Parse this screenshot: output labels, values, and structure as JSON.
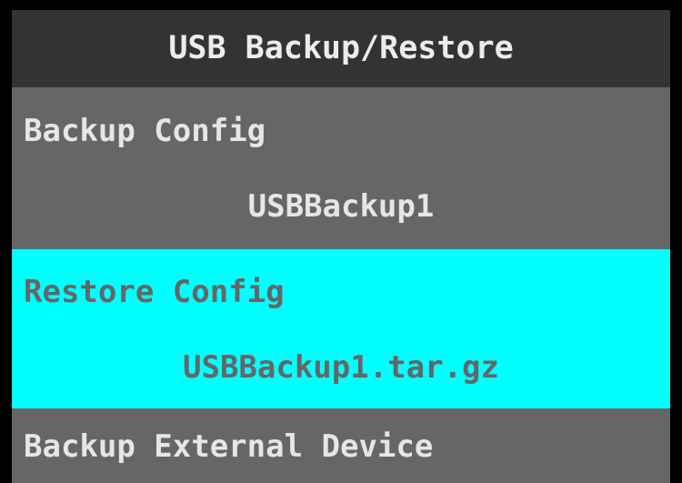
{
  "title": "USB Backup/Restore",
  "menu": {
    "backup": {
      "label": "Backup Config",
      "value": "USBBackup1"
    },
    "restore": {
      "label": "Restore Config",
      "value": "USBBackup1.tar.gz",
      "selected": true
    },
    "external": {
      "label": "Backup External Device"
    }
  },
  "colors": {
    "title_bg": "#333333",
    "item_bg": "#666666",
    "selected_bg": "#00ffff",
    "text": "#e6e6e6",
    "selected_text": "#666666",
    "border": "#000000"
  }
}
